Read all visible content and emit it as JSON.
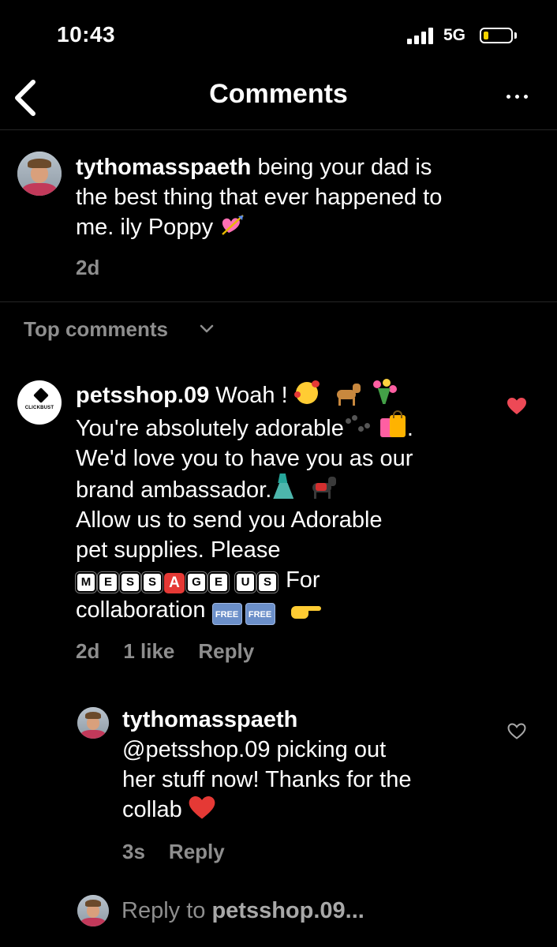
{
  "status": {
    "time": "10:43",
    "network": "5G"
  },
  "nav": {
    "title": "Comments"
  },
  "caption": {
    "username": "tythomasspaeth",
    "text_line1": "being your dad is",
    "text_line2": "the best thing that ever happened to",
    "text_line3": "me. ily Poppy",
    "time": "2d"
  },
  "top_comments_label": "Top comments",
  "comment": {
    "username": "petsshop.09",
    "avatar_label": "CLICKBUST",
    "line1": "Woah !",
    "line2": "You're absolutely adorable",
    "line2_end": ".",
    "line3": "We'd love you to have you as our",
    "line4": "brand ambassador.",
    "line5": "Allow us to send you Adorable",
    "line6": "pet supplies. Please",
    "message_keycaps": [
      "M",
      "E",
      "S",
      "S",
      "A",
      "G",
      "E",
      "U",
      "S"
    ],
    "line7_end": "For",
    "line8": "collaboration",
    "free_badge": "FREE",
    "time": "2d",
    "likes": "1 like",
    "reply_label": "Reply"
  },
  "reply": {
    "username": "tythomasspaeth",
    "line1": "@petsshop.09 picking out",
    "line2": "her stuff now! Thanks for the",
    "line3": "collab",
    "time": "3s",
    "reply_label": "Reply"
  },
  "reply_input": {
    "prefix": "Reply to",
    "target": "petsshop.09..."
  },
  "colors": {
    "bg": "#000000",
    "muted": "#8e8e8e",
    "like_red": "#ed4956",
    "battery": "#f5d400"
  },
  "icons": [
    "back-chevron-icon",
    "more-icon",
    "chevron-down-icon",
    "heart-filled-icon",
    "heart-outline-icon"
  ]
}
